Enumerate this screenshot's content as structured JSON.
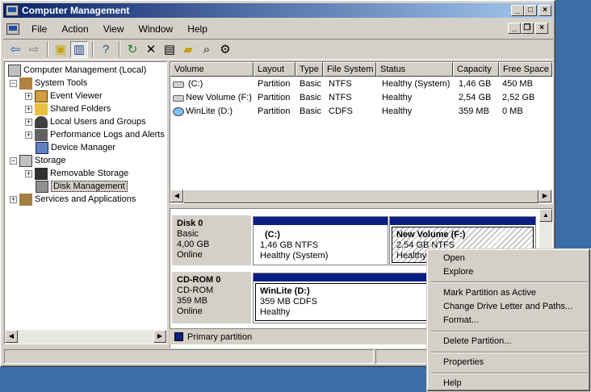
{
  "window": {
    "title": "Computer Management"
  },
  "menu": [
    "File",
    "Action",
    "View",
    "Window",
    "Help"
  ],
  "tree": {
    "root": "Computer Management (Local)",
    "system_tools": "System Tools",
    "event_viewer": "Event Viewer",
    "shared_folders": "Shared Folders",
    "local_users": "Local Users and Groups",
    "perf_logs": "Performance Logs and Alerts",
    "device_manager": "Device Manager",
    "storage": "Storage",
    "removable_storage": "Removable Storage",
    "disk_management": "Disk Management",
    "services": "Services and Applications"
  },
  "volumes": {
    "columns": [
      "Volume",
      "Layout",
      "Type",
      "File System",
      "Status",
      "Capacity",
      "Free Space"
    ],
    "rows": [
      [
        "(C:)",
        "Partition",
        "Basic",
        "NTFS",
        "Healthy (System)",
        "1,46 GB",
        "450 MB"
      ],
      [
        "New Volume (F:)",
        "Partition",
        "Basic",
        "NTFS",
        "Healthy",
        "2,54 GB",
        "2,52 GB"
      ],
      [
        "WinLite (D:)",
        "Partition",
        "Basic",
        "CDFS",
        "Healthy",
        "359 MB",
        "0 MB"
      ]
    ]
  },
  "disks": {
    "disk0": {
      "name": "Disk 0",
      "type": "Basic",
      "size": "4,00 GB",
      "state": "Online"
    },
    "disk0_c": {
      "name": "(C:)",
      "detail": "1,46 GB NTFS",
      "status": "Healthy (System)"
    },
    "disk0_f": {
      "name": "New Volume  (F:)",
      "detail": "2,54 GB NTFS",
      "status": "Healthy"
    },
    "cdrom0": {
      "name": "CD-ROM 0",
      "type": "CD-ROM",
      "size": "359 MB",
      "state": "Online"
    },
    "cdrom0_d": {
      "name": "WinLite  (D:)",
      "detail": "359 MB CDFS",
      "status": "Healthy"
    }
  },
  "legend": {
    "primary": "Primary partition"
  },
  "context_menu": {
    "open": "Open",
    "explore": "Explore",
    "mark_active": "Mark Partition as Active",
    "change_letter": "Change Drive Letter and Paths...",
    "format": "Format...",
    "delete": "Delete Partition...",
    "properties": "Properties",
    "help": "Help"
  },
  "colors": {
    "titlebar_start": "#0a246a",
    "titlebar_end": "#a6caf0",
    "desktop": "#3a6ea5",
    "partition_bar": "#0a1e85"
  }
}
